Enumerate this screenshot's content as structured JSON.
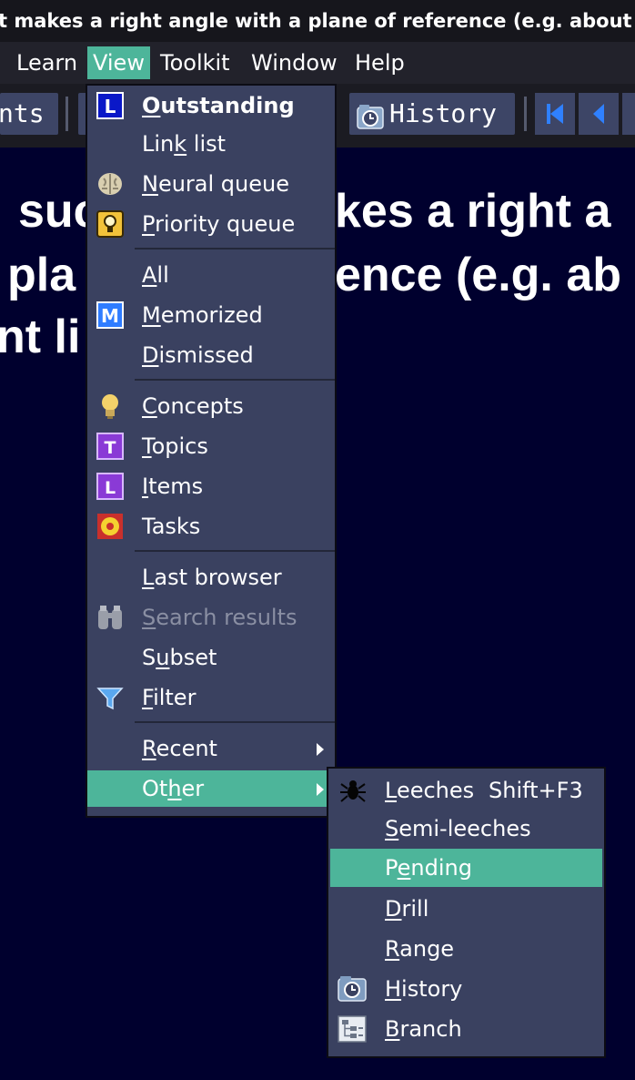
{
  "window": {
    "title": "t makes a right angle with a plane of reference (e.g. about a st"
  },
  "menubar": {
    "items": [
      {
        "label": "Learn"
      },
      {
        "label": "View"
      },
      {
        "label": "Toolkit"
      },
      {
        "label": "Window"
      },
      {
        "label": "Help"
      }
    ]
  },
  "toolbar": {
    "contents_label": "nts",
    "history_label": "History"
  },
  "content": {
    "line1": "suc",
    "line1b": "kes a right a",
    "line2": "pla",
    "line2b": "ence (e.g. ab",
    "line3": "nt li"
  },
  "view_menu": {
    "items": [
      {
        "pre": "",
        "u": "O",
        "post": "utstanding",
        "icon": "outstanding-l-icon"
      },
      {
        "pre": "Lin",
        "u": "k",
        "post": " list",
        "icon": ""
      },
      {
        "pre": "",
        "u": "N",
        "post": "eural queue",
        "icon": "brain-icon"
      },
      {
        "pre": "",
        "u": "P",
        "post": "riority queue",
        "icon": "priority-bulb-icon"
      },
      {
        "pre": "",
        "u": "A",
        "post": "ll",
        "icon": ""
      },
      {
        "pre": "",
        "u": "M",
        "post": "emorized",
        "icon": "memorized-m-icon"
      },
      {
        "pre": "",
        "u": "D",
        "post": "ismissed",
        "icon": ""
      },
      {
        "pre": "",
        "u": "C",
        "post": "oncepts",
        "icon": "lightbulb-icon"
      },
      {
        "pre": "",
        "u": "T",
        "post": "opics",
        "icon": "topic-t-icon"
      },
      {
        "pre": "",
        "u": "I",
        "post": "tems",
        "icon": "item-l-icon"
      },
      {
        "pre": "Tasks",
        "u": "",
        "post": "",
        "icon": "tasks-icon"
      },
      {
        "pre": "",
        "u": "L",
        "post": "ast browser",
        "icon": ""
      },
      {
        "pre": "",
        "u": "S",
        "post": "earch results",
        "icon": "binoculars-icon"
      },
      {
        "pre": "S",
        "u": "u",
        "post": "bset",
        "icon": ""
      },
      {
        "pre": "",
        "u": "F",
        "post": "ilter",
        "icon": "filter-funnel-icon"
      },
      {
        "pre": "",
        "u": "R",
        "post": "ecent",
        "icon": ""
      },
      {
        "pre": "Ot",
        "u": "h",
        "post": "er",
        "icon": ""
      }
    ]
  },
  "other_submenu": {
    "items": [
      {
        "pre": "",
        "u": "L",
        "post": "eeches",
        "shortcut": "Shift+F3",
        "icon": "leech-spider-icon"
      },
      {
        "pre": "",
        "u": "S",
        "post": "emi-leeches",
        "shortcut": "",
        "icon": ""
      },
      {
        "pre": "P",
        "u": "e",
        "post": "nding",
        "shortcut": "",
        "icon": ""
      },
      {
        "pre": "",
        "u": "D",
        "post": "rill",
        "shortcut": "",
        "icon": ""
      },
      {
        "pre": "",
        "u": "R",
        "post": "ange",
        "shortcut": "",
        "icon": ""
      },
      {
        "pre": "",
        "u": "H",
        "post": "istory",
        "shortcut": "",
        "icon": "history-clock-icon"
      },
      {
        "pre": "",
        "u": "B",
        "post": "ranch",
        "shortcut": "",
        "icon": "branch-tree-icon"
      }
    ]
  },
  "colors": {
    "accent": "#4db59a",
    "menu_bg": "#3a4160",
    "content_bg": "#00002e"
  }
}
